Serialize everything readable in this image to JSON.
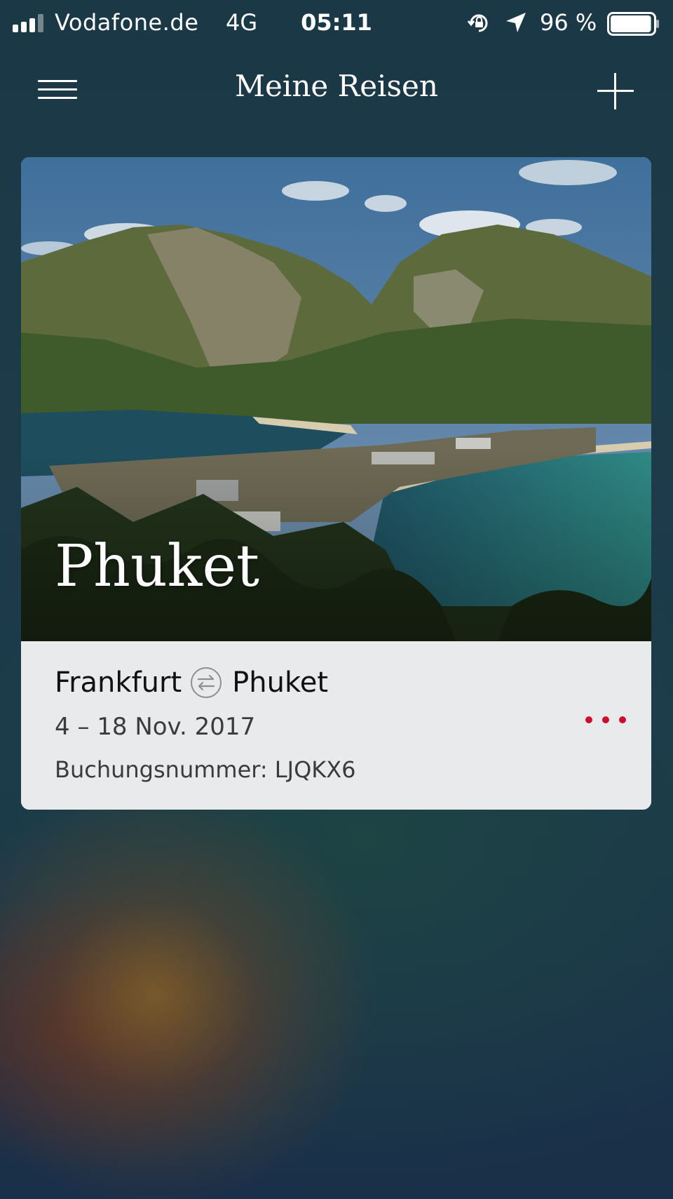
{
  "status_bar": {
    "carrier": "Vodafone.de",
    "network": "4G",
    "time": "05:11",
    "battery": "96 %",
    "signal_bars": 3,
    "signal_total": 4,
    "battery_level": 0.96
  },
  "nav": {
    "title": "Meine Reisen",
    "menu_icon": "hamburger-menu-icon",
    "add_icon": "plus-icon"
  },
  "trip": {
    "destination": "Phuket",
    "origin": "Frankfurt",
    "route_icon": "round-trip-arrows-icon",
    "dates": "4 – 18 Nov. 2017",
    "booking": "Buchungsnummer: LJQKX6",
    "more_icon": "more-dots-icon"
  },
  "colors": {
    "accent_red": "#c8102e",
    "card_bg": "#e9eaec"
  }
}
